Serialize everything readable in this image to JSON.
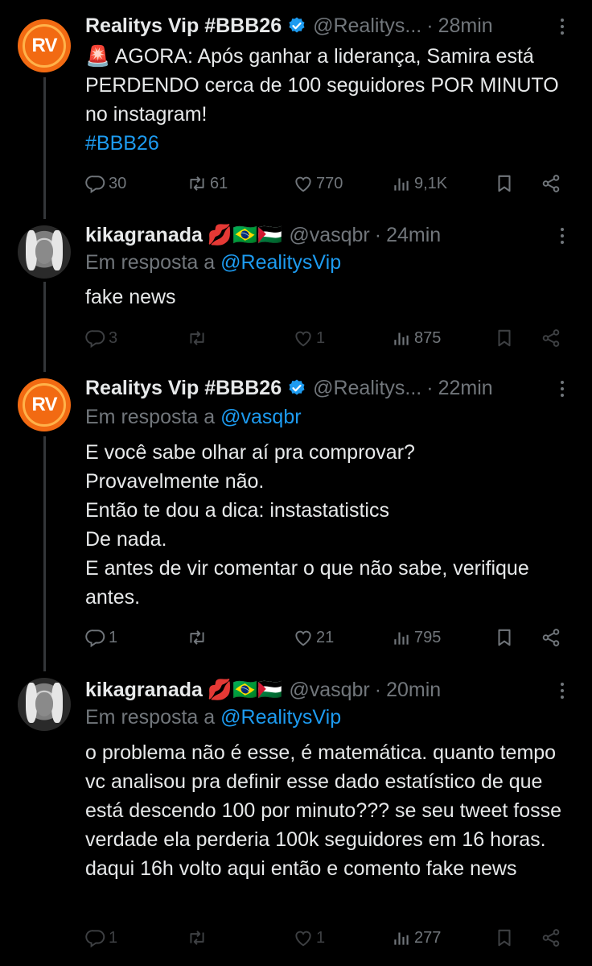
{
  "tweets": [
    {
      "author": "Realitys Vip #BBB26",
      "handle": "@Realitys...",
      "separator": "·",
      "time": "28min",
      "reply_label": "",
      "reply_to": "",
      "text": "🚨 AGORA: Após ganhar a liderança, Samira está PERDENDO cerca de 100 seguidores POR MINUTO no instagram!",
      "hashtag": "#BBB26",
      "replies": "30",
      "retweets": "61",
      "likes": "770",
      "views": "9,1K"
    },
    {
      "author": "kikagranada",
      "author_emojis": "💋🇧🇷🇵🇸",
      "handle": "@vasqbr",
      "separator": "·",
      "time": "24min",
      "reply_label": "Em resposta a",
      "reply_to": "@RealitysVip",
      "text": "fake news",
      "replies": "3",
      "retweets": "",
      "likes": "1",
      "views": "875"
    },
    {
      "author": "Realitys Vip #BBB26",
      "handle": "@Realitys...",
      "separator": "·",
      "time": "22min",
      "reply_label": "Em resposta a",
      "reply_to": "@vasqbr",
      "text": "E você sabe olhar aí pra comprovar?\nProvavelmente não.\nEntão te dou a dica: instastatistics\nDe nada.\nE antes de vir comentar o que não sabe, verifique antes.",
      "replies": "1",
      "retweets": "",
      "likes": "21",
      "views": "795"
    },
    {
      "author": "kikagranada",
      "author_emojis": "💋🇧🇷🇵🇸",
      "handle": "@vasqbr",
      "separator": "·",
      "time": "20min",
      "reply_label": "Em resposta a",
      "reply_to": "@RealitysVip",
      "text": "o problema não é esse, é matemática. quanto tempo vc analisou pra definir esse dado estatístico de que está descendo 100 por minuto??? se seu tweet fosse verdade ela perderia 100k seguidores em 16 horas. daqui 16h volto aqui então e comento fake news",
      "replies": "1",
      "retweets": "",
      "likes": "1",
      "views": "277"
    }
  ],
  "avatars": {
    "rv_initials": "RV"
  },
  "colors": {
    "background": "#000000",
    "text": "#e7e9ea",
    "muted": "#71767b",
    "link": "#1d9bf0",
    "verified": "#1d9bf0",
    "rv_orange": "#f26a12"
  },
  "icons": [
    "reply-icon",
    "retweet-icon",
    "like-icon",
    "views-icon",
    "bookmark-icon",
    "share-icon",
    "more-icon",
    "verified-badge-icon",
    "siren-emoji"
  ]
}
